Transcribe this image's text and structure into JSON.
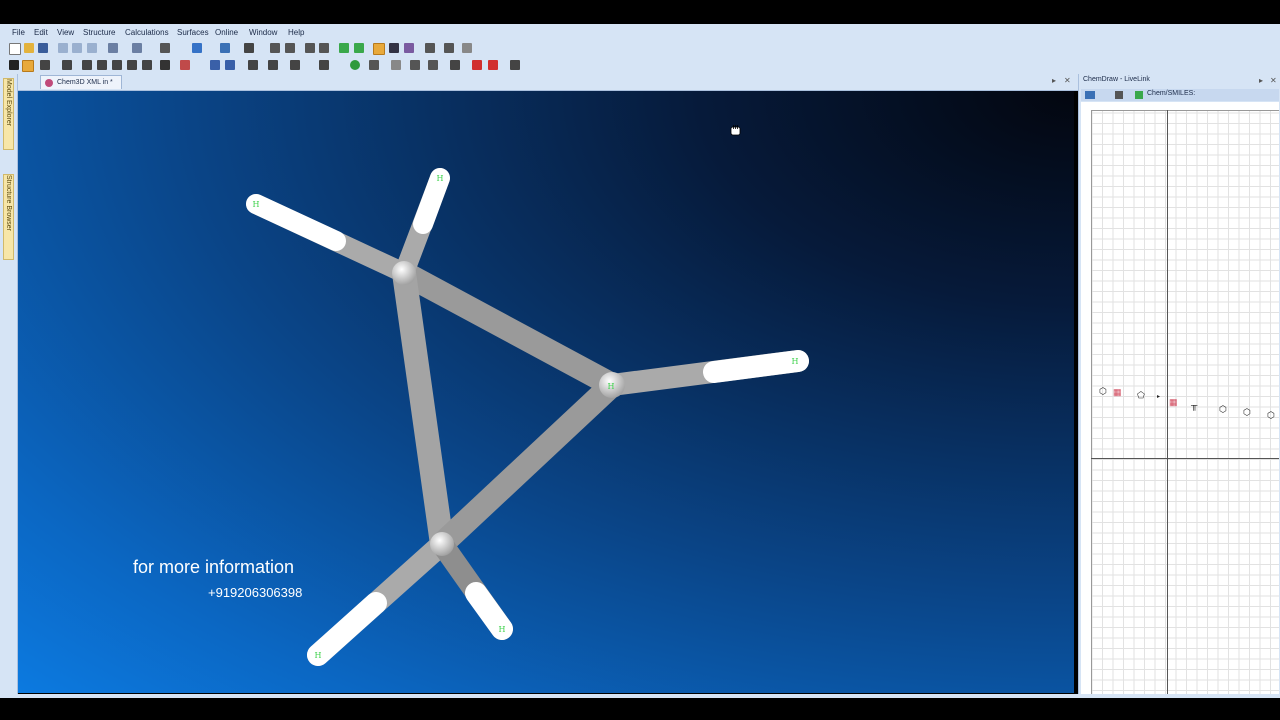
{
  "menu": [
    "File",
    "Edit",
    "View",
    "Structure",
    "Calculations",
    "Surfaces",
    "Online",
    "Window",
    "Help"
  ],
  "tab": {
    "label": "Chem3D XML in *"
  },
  "side_tabs": {
    "model_explorer": "Model Explorer",
    "structure_browser": "Structure Browser"
  },
  "right_panel": {
    "title": "ChemDraw - LiveLink",
    "smiles_label": "Chem/SMILES:"
  },
  "overlay": {
    "line1": "for more information",
    "line2": "+919206306398"
  },
  "atoms": [
    {
      "label": "H"
    },
    {
      "label": "H"
    },
    {
      "label": "H"
    },
    {
      "label": "H"
    },
    {
      "label": "H"
    },
    {
      "label": "H"
    }
  ],
  "colors": {
    "bond": "#a9a9a9",
    "hydrogen_cap": "#ffffff",
    "atom_label": "#3cd24a",
    "viewport_bg_start": "#03060f",
    "viewport_bg_end": "#0c7ae0",
    "chrome": "#d6e4f5"
  }
}
